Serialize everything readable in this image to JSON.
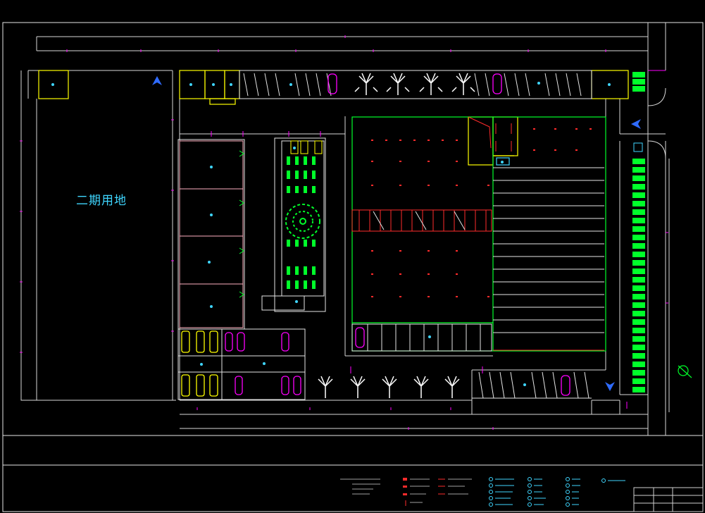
{
  "drawing": {
    "phase2_label": "二期用地",
    "colors": {
      "background": "#000000",
      "outline": "#d8d8d8",
      "dimension": "#ff00ff",
      "greenery": "#00ff2a",
      "building": "#ffff00",
      "cyan_text": "#3fd6ff",
      "arrow": "#2f6bff",
      "red_marks": "#ff2b2b"
    },
    "icons": [
      "north-arrow-icon",
      "entrance-arrow-icon",
      "tree-icon",
      "shrub-icon",
      "car-icon"
    ]
  }
}
